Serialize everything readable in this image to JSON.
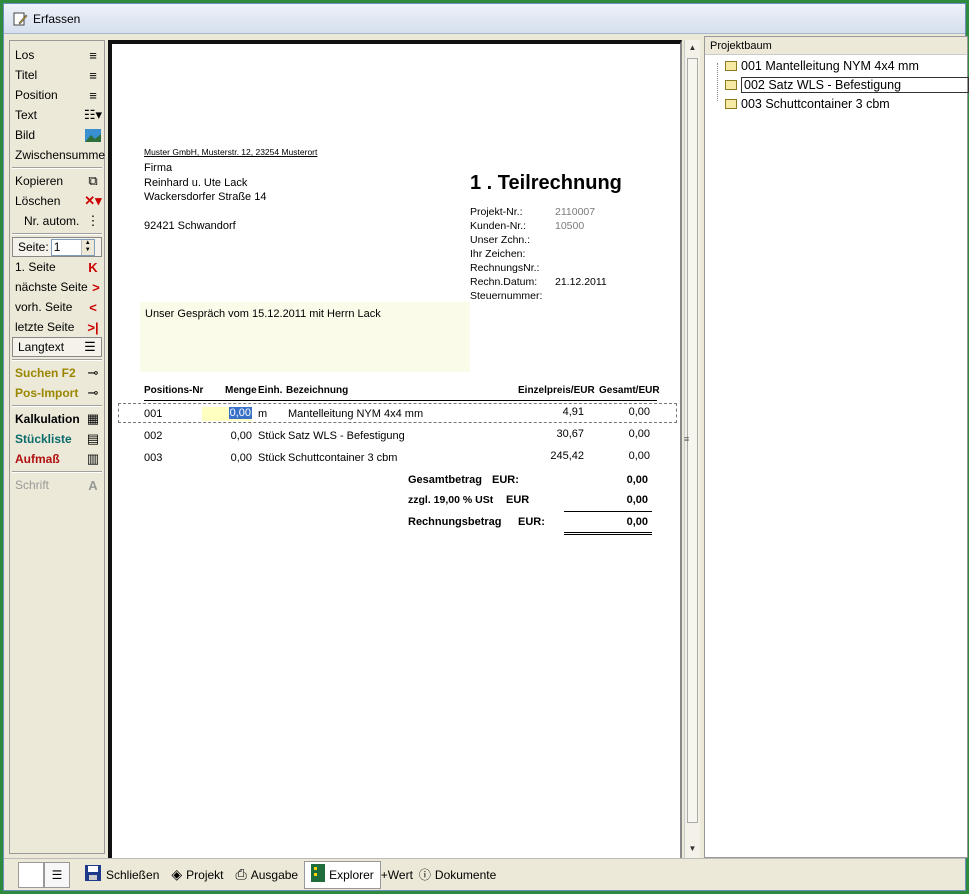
{
  "window": {
    "title": "Erfassen"
  },
  "toolbar": {
    "items": [
      {
        "label": "Los",
        "icon": "paragraph-icon"
      },
      {
        "label": "Titel",
        "icon": "paragraph-icon"
      },
      {
        "label": "Position",
        "icon": "paragraph-icon"
      },
      {
        "label": "Text",
        "icon": "text-block-icon"
      },
      {
        "label": "Bild",
        "icon": "image-icon"
      },
      {
        "label": "Zwischensumme",
        "icon": ""
      }
    ],
    "kopieren": "Kopieren",
    "loeschen": "Löschen",
    "nr_autom": "Nr. autom.",
    "seite_label": "Seite:",
    "seite_value": "1",
    "first_page": "1. Seite",
    "next_page": "nächste Seite",
    "prev_page": "vorh. Seite",
    "last_page": "letzte Seite",
    "langtext": "Langtext",
    "suchen": "Suchen F2",
    "pos_import": "Pos-Import",
    "kalkulation": "Kalkulation",
    "stueckliste": "Stückliste",
    "aufmass": "Aufmaß",
    "schrift": "Schrift"
  },
  "document": {
    "sender_line": "Muster GmbH, Musterstr. 12, 23254 Musterort",
    "address": [
      "Firma",
      "Reinhard u. Ute Lack",
      "Wackersdorfer Straße 14",
      "",
      "92421 Schwandorf"
    ],
    "invoice_title": "1  . Teilrechnung",
    "meta": [
      {
        "key": "Projekt-Nr.:",
        "value": "2110007"
      },
      {
        "key": "Kunden-Nr.:",
        "value": "10500"
      },
      {
        "key": "Unser Zchn.:",
        "value": ""
      },
      {
        "key": "Ihr Zeichen:",
        "value": ""
      },
      {
        "key": "RechnungsNr.:",
        "value": ""
      },
      {
        "key": "Rechn.Datum:",
        "value": "21.12.2011"
      },
      {
        "key": "Steuernummer:",
        "value": ""
      }
    ],
    "note": "Unser Gespräch vom 15.12.2011 mit Herrn Lack",
    "headers": {
      "pos": "Positions-Nr",
      "menge": "Menge",
      "einh": "Einh.",
      "bez": "Bezeichnung",
      "ep": "Einzelpreis/EUR",
      "gp": "Gesamt/EUR"
    },
    "rows": [
      {
        "pos": "001",
        "menge": "0,00",
        "einh": "m",
        "bez": "Mantelleitung NYM 4x4 mm",
        "ep": "4,91",
        "gp": "0,00"
      },
      {
        "pos": "002",
        "menge": "0,00",
        "einh": "Stück",
        "bez": "Satz WLS - Befestigung",
        "ep": "30,67",
        "gp": "0,00"
      },
      {
        "pos": "003",
        "menge": "0,00",
        "einh": "Stück",
        "bez": "Schuttcontainer 3 cbm",
        "ep": "245,42",
        "gp": "0,00"
      }
    ],
    "totals": {
      "gesamt_label": "Gesamtbetrag",
      "gesamt_cur": "EUR:",
      "gesamt_val": "0,00",
      "ust_label": "zzgl.   19,00 % USt",
      "ust_cur": "EUR",
      "ust_val": "0,00",
      "rb_label": "Rechnungsbetrag",
      "rb_cur": "EUR:",
      "rb_val": "0,00"
    }
  },
  "tree": {
    "title": "Projektbaum",
    "nodes": [
      {
        "label": "001 Mantelleitung NYM 4x4 mm"
      },
      {
        "label": "002 Satz WLS - Befestigung"
      },
      {
        "label": "003 Schuttcontainer 3 cbm"
      }
    ]
  },
  "bottombar": {
    "schliessen": "Schließen",
    "projekt": "Projekt",
    "ausgabe": "Ausgabe",
    "explorer": "Explorer",
    "wert": "+Wert",
    "dokumente": "Dokumente"
  }
}
